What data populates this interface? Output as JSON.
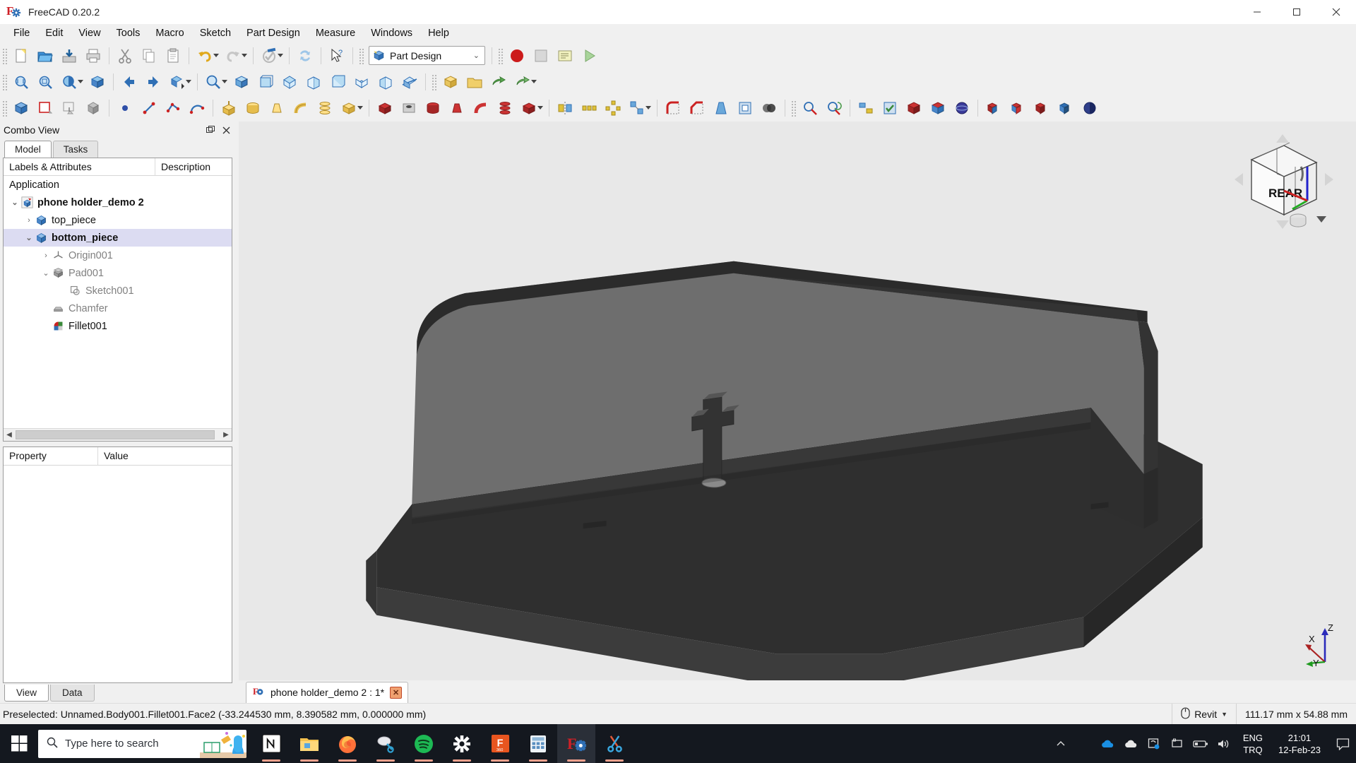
{
  "window": {
    "title": "FreeCAD 0.20.2",
    "app_icon": "freecad-icon",
    "minimize": "─",
    "maximize": "☐",
    "close": "✕"
  },
  "menubar": {
    "items": [
      "File",
      "Edit",
      "View",
      "Tools",
      "Macro",
      "Sketch",
      "Part Design",
      "Measure",
      "Windows",
      "Help"
    ]
  },
  "toolbars": {
    "file": [
      "new-document-icon",
      "open-document-icon",
      "save-document-icon",
      "print-icon",
      "cut-icon",
      "copy-icon",
      "paste-icon",
      "undo-icon",
      "redo-icon",
      "refresh-icon",
      "whats-this-icon"
    ],
    "workbench": {
      "label": "Part Design",
      "icon": "part-design-workbench-icon",
      "chevron": "⌄"
    },
    "macro": [
      "macro-record-icon",
      "macro-stop-icon",
      "macro-edit-icon",
      "macro-execute-icon"
    ],
    "view_row": [
      "fit-all-icon",
      "fit-selection-icon",
      "draw-style-icon",
      "axonometric-icon",
      "back-arrow-icon",
      "forward-arrow-icon",
      "link-navigation-icon",
      "zoom-icon",
      "isometric-view-icon",
      "front-view-icon",
      "top-view-icon",
      "right-view-icon",
      "rear-view-icon",
      "bottom-view-icon",
      "left-view-icon",
      "section-view-icon",
      "create-part-icon",
      "create-group-icon",
      "make-link-icon",
      "link-actions-icon"
    ],
    "partdesign_row": [
      "create-body-icon",
      "create-sketch-icon",
      "edit-sketch-icon",
      "map-sketch-icon",
      "create-point-icon",
      "create-line-icon",
      "create-polyline-icon",
      "create-arc-icon",
      "create-datum-plane-icon",
      "create-datum-line-icon",
      "create-datum-point-icon",
      "pad-icon",
      "revolution-icon",
      "additive-loft-icon",
      "additive-pipe-icon",
      "additive-helix-icon",
      "additive-primitive-icon",
      "pocket-icon",
      "hole-icon",
      "groove-icon",
      "subtractive-loft-icon",
      "subtractive-pipe-icon",
      "subtractive-helix-icon",
      "subtractive-primitive-icon",
      "mirrored-icon",
      "linear-pattern-icon",
      "polar-pattern-icon",
      "multi-transform-icon",
      "fillet-icon",
      "chamfer-icon",
      "draft-icon",
      "thickness-icon",
      "boolean-icon",
      "measure-icon",
      "measure-refresh-icon",
      "toggle-icon",
      "validate-icon",
      "check-geometry-icon",
      "defeaturing-icon",
      "scale-icon"
    ]
  },
  "combo_view": {
    "title": "Combo View",
    "float_icon": "undock-icon",
    "close_icon": "close-icon",
    "tabs": [
      {
        "label": "Model",
        "active": true
      },
      {
        "label": "Tasks",
        "active": false
      }
    ],
    "tree_headers": [
      "Labels & Attributes",
      "Description"
    ],
    "tree": [
      {
        "label": "Application",
        "depth": 0,
        "twisty": "",
        "icon": "",
        "bold": false,
        "dim": false,
        "selected": false
      },
      {
        "label": "phone holder_demo 2",
        "depth": 1,
        "twisty": "⌄",
        "icon": "document-icon",
        "bold": true,
        "dim": false,
        "selected": false
      },
      {
        "label": "top_piece",
        "depth": 2,
        "twisty": "›",
        "icon": "body-icon",
        "bold": false,
        "dim": false,
        "selected": false
      },
      {
        "label": "bottom_piece",
        "depth": 2,
        "twisty": "⌄",
        "icon": "body-icon",
        "bold": true,
        "dim": false,
        "selected": true
      },
      {
        "label": "Origin001",
        "depth": 3,
        "twisty": "›",
        "icon": "origin-icon",
        "bold": false,
        "dim": true,
        "selected": false
      },
      {
        "label": "Pad001",
        "depth": 3,
        "twisty": "⌄",
        "icon": "pad-icon",
        "bold": false,
        "dim": true,
        "selected": false
      },
      {
        "label": "Sketch001",
        "depth": 4,
        "twisty": "",
        "icon": "sketch-icon",
        "bold": false,
        "dim": true,
        "selected": false
      },
      {
        "label": "Chamfer",
        "depth": 3,
        "twisty": "",
        "icon": "chamfer-icon",
        "bold": false,
        "dim": true,
        "selected": false
      },
      {
        "label": "Fillet001",
        "depth": 3,
        "twisty": "",
        "icon": "fillet-icon",
        "bold": false,
        "dim": false,
        "selected": false
      }
    ],
    "property_headers": [
      "Property",
      "Value"
    ],
    "property_rows": [],
    "bottom_tabs": [
      {
        "label": "View",
        "active": true
      },
      {
        "label": "Data",
        "active": false
      }
    ]
  },
  "view3d": {
    "navcube_label": "REAR",
    "axis_labels": {
      "z": "Z",
      "x": "X",
      "y": "Y"
    },
    "background_color": "#e8e8e8",
    "model_face_light": "#6e6e6e",
    "model_face_dark": "#2f2f2f",
    "model_face_mid": "#3a3a3a"
  },
  "document_tab": {
    "label": "phone holder_demo 2 : 1*",
    "icon": "freecad-icon",
    "close": "✕"
  },
  "statusbar": {
    "message": "Preselected: Unnamed.Body001.Fillet001.Face2 (-33.244530 mm, 8.390582 mm, 0.000000 mm)",
    "nav_style": {
      "icon": "mouse-icon",
      "label": "Revit",
      "chevron": "▼"
    },
    "dimensions": "111.17 mm x 54.88 mm"
  },
  "taskbar": {
    "start_icon": "windows-start-icon",
    "search_placeholder": "Type here to search",
    "search_icon": "search-icon",
    "apps": [
      {
        "name": "notion",
        "label": "Notion"
      },
      {
        "name": "file-explorer",
        "label": "File Explorer"
      },
      {
        "name": "firefox",
        "label": "Firefox"
      },
      {
        "name": "snip-sketch",
        "label": "Snip & Sketch"
      },
      {
        "name": "spotify",
        "label": "Spotify"
      },
      {
        "name": "settings",
        "label": "Settings"
      },
      {
        "name": "fusion360",
        "label": "Fusion 360"
      },
      {
        "name": "calculator",
        "label": "Calculator"
      },
      {
        "name": "freecad",
        "label": "FreeCAD"
      },
      {
        "name": "snipping-tool",
        "label": "Snipping Tool"
      }
    ],
    "tray": {
      "show_hidden": "∧",
      "icons": [
        "camera-icon",
        "onedrive-blue-icon",
        "onedrive-white-icon",
        "sync-icon",
        "display-icon",
        "battery-icon",
        "volume-icon"
      ],
      "language_top": "ENG",
      "language_bottom": "TRQ",
      "time": "21:01",
      "date": "12-Feb-23",
      "action_center": "notification-icon"
    }
  }
}
